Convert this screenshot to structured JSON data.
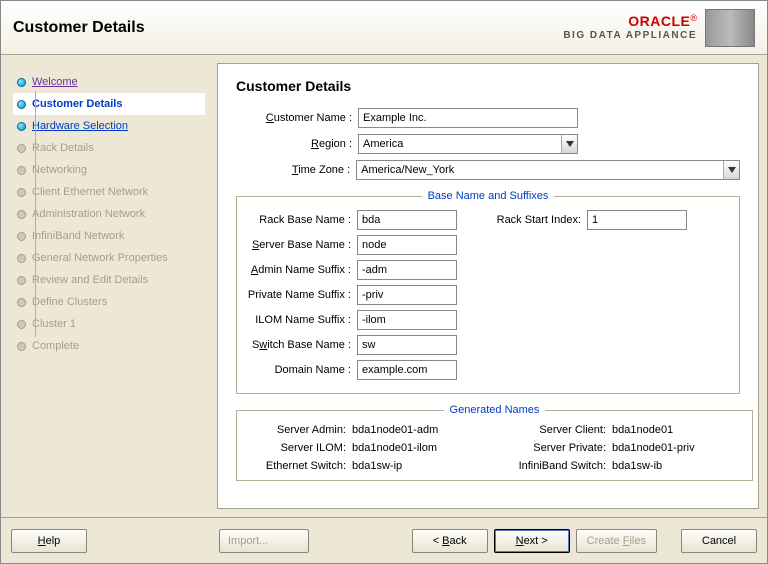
{
  "header": {
    "title": "Customer Details",
    "brand": "ORACLE",
    "brand_reg": "®",
    "sub": "BIG DATA APPLIANCE"
  },
  "steps": [
    {
      "label": "Welcome",
      "state": "done"
    },
    {
      "label": "Customer Details",
      "state": "active"
    },
    {
      "label": "Hardware Selection",
      "state": "link"
    },
    {
      "label": "Rack Details",
      "state": "future"
    },
    {
      "label": "Networking",
      "state": "future"
    },
    {
      "label": "Client Ethernet Network",
      "state": "future"
    },
    {
      "label": "Administration Network",
      "state": "future"
    },
    {
      "label": "InfiniBand Network",
      "state": "future"
    },
    {
      "label": "General Network Properties",
      "state": "future"
    },
    {
      "label": "Review and Edit Details",
      "state": "future"
    },
    {
      "label": "Define Clusters",
      "state": "future"
    },
    {
      "label": "Cluster 1",
      "state": "future"
    },
    {
      "label": "Complete",
      "state": "future"
    }
  ],
  "main": {
    "title": "Customer Details",
    "labels": {
      "customer_name": "Customer Name :",
      "cn_u": "C",
      "region": "Region :",
      "rg_u": "R",
      "time_zone": "Time Zone :",
      "tz_u": "T",
      "rack_base": "Rack Base Name :",
      "rack_start": "Rack Start Index:",
      "server_base": "Server Base Name :",
      "sb_u": "S",
      "admin_suffix": "Admin Name Suffix :",
      "as_u": "A",
      "private_suffix": "Private Name Suffix :",
      "ilom_suffix": "ILOM Name Suffix :",
      "switch_base": "Switch Base Name :",
      "sw_u": "w",
      "domain": "Domain Name :",
      "fs1_legend": "Base Name and Suffixes",
      "fs2_legend": "Generated Names",
      "gen_server_admin": "Server Admin:",
      "gen_server_client": "Server Client:",
      "gen_server_ilom": "Server ILOM:",
      "gen_server_private": "Server Private:",
      "gen_eth_switch": "Ethernet Switch:",
      "gen_ib_switch": "InfiniBand Switch:"
    },
    "values": {
      "customer_name": "Example Inc.",
      "region": "America",
      "time_zone": "America/New_York",
      "rack_base": "bda",
      "rack_start": "1",
      "server_base": "node",
      "admin_suffix": "-adm",
      "private_suffix": "-priv",
      "ilom_suffix": "-ilom",
      "switch_base": "sw",
      "domain": "example.com",
      "gen_server_admin": "bda1node01-adm",
      "gen_server_client": "bda1node01",
      "gen_server_ilom": "bda1node01-ilom",
      "gen_server_private": "bda1node01-priv",
      "gen_eth_switch": "bda1sw-ip",
      "gen_ib_switch": "bda1sw-ib"
    }
  },
  "footer": {
    "help": "Help",
    "help_u": "H",
    "import": "Import...",
    "back": "< Back",
    "back_u": "B",
    "next": "Next >",
    "next_u": "N",
    "create": "Create Files",
    "create_u": "F",
    "cancel": "Cancel"
  }
}
